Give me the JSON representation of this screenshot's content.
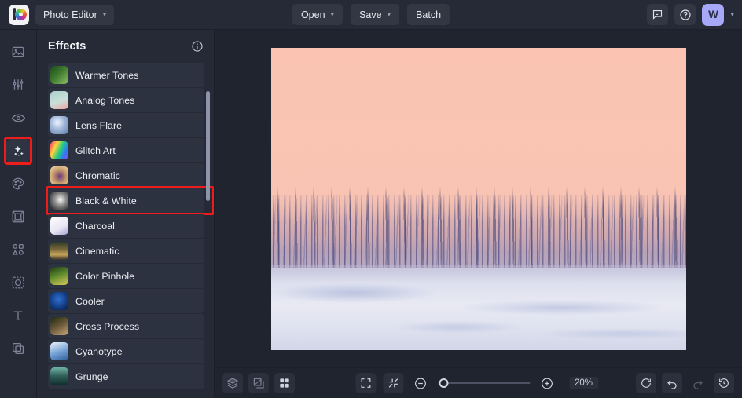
{
  "header": {
    "logo_icon": "color-wheel-logo-icon",
    "app_menu_label": "Photo Editor",
    "app_menu_chevron": "chevron-down-icon",
    "open_label": "Open",
    "save_label": "Save",
    "batch_label": "Batch",
    "feedback_icon": "chat-bubble-icon",
    "help_icon": "question-circle-icon",
    "avatar_initial": "W",
    "avatar_chevron": "chevron-down-icon",
    "avatar_color": "#a7a8f7"
  },
  "rail": {
    "items": [
      {
        "name": "image-icon",
        "label": "Image"
      },
      {
        "name": "adjust-sliders-icon",
        "label": "Adjust"
      },
      {
        "name": "eye-retouch-icon",
        "label": "Retouch"
      },
      {
        "name": "sparkles-effects-icon",
        "label": "Effects",
        "selected": true,
        "highlighted": true
      },
      {
        "name": "palette-icon",
        "label": "Paint"
      },
      {
        "name": "frame-icon",
        "label": "Frames"
      },
      {
        "name": "shapes-icon",
        "label": "Shapes"
      },
      {
        "name": "sticker-cutout-icon",
        "label": "Stickers"
      },
      {
        "name": "text-icon",
        "label": "Text"
      },
      {
        "name": "overlay-layers-icon",
        "label": "Overlays"
      }
    ]
  },
  "panel": {
    "title": "Effects",
    "info_icon": "info-circle-icon",
    "highlight_color": "#ef1c1c",
    "effects": [
      {
        "label": "Warmer Tones",
        "thumb": "palm-leaves-thumb"
      },
      {
        "label": "Analog Tones",
        "thumb": "flamingo-thumb"
      },
      {
        "label": "Lens Flare",
        "thumb": "lens-flare-thumb"
      },
      {
        "label": "Glitch Art",
        "thumb": "glitch-portrait-thumb"
      },
      {
        "label": "Chromatic",
        "thumb": "chromatic-swirl-thumb"
      },
      {
        "label": "Black & White",
        "thumb": "bw-swan-thumb",
        "highlighted": true
      },
      {
        "label": "Charcoal",
        "thumb": "charcoal-sketch-thumb"
      },
      {
        "label": "Cinematic",
        "thumb": "cinematic-strip-thumb"
      },
      {
        "label": "Color Pinhole",
        "thumb": "pinhole-building-thumb"
      },
      {
        "label": "Cooler",
        "thumb": "cool-blue-thumb"
      },
      {
        "label": "Cross Process",
        "thumb": "cross-process-portrait-thumb"
      },
      {
        "label": "Cyanotype",
        "thumb": "cyanotype-fern-thumb"
      },
      {
        "label": "Grunge",
        "thumb": "grunge-landscape-thumb"
      }
    ]
  },
  "canvas": {
    "image_alt": "winter-landscape-frosted-trees-snow-pink-sky"
  },
  "bottombar": {
    "layers_icon": "layers-icon",
    "transform_icon": "transform-icon",
    "grid_icon": "grid-view-icon",
    "fullscreen_icon": "fullscreen-icon",
    "fit_screen_icon": "fit-to-screen-icon",
    "zoom_out_icon": "zoom-out-icon",
    "zoom_in_icon": "zoom-in-icon",
    "zoom_value": "20%",
    "reset_icon": "reset-rotate-icon",
    "undo_icon": "undo-icon",
    "redo_icon": "redo-icon",
    "history_icon": "history-clock-icon"
  }
}
